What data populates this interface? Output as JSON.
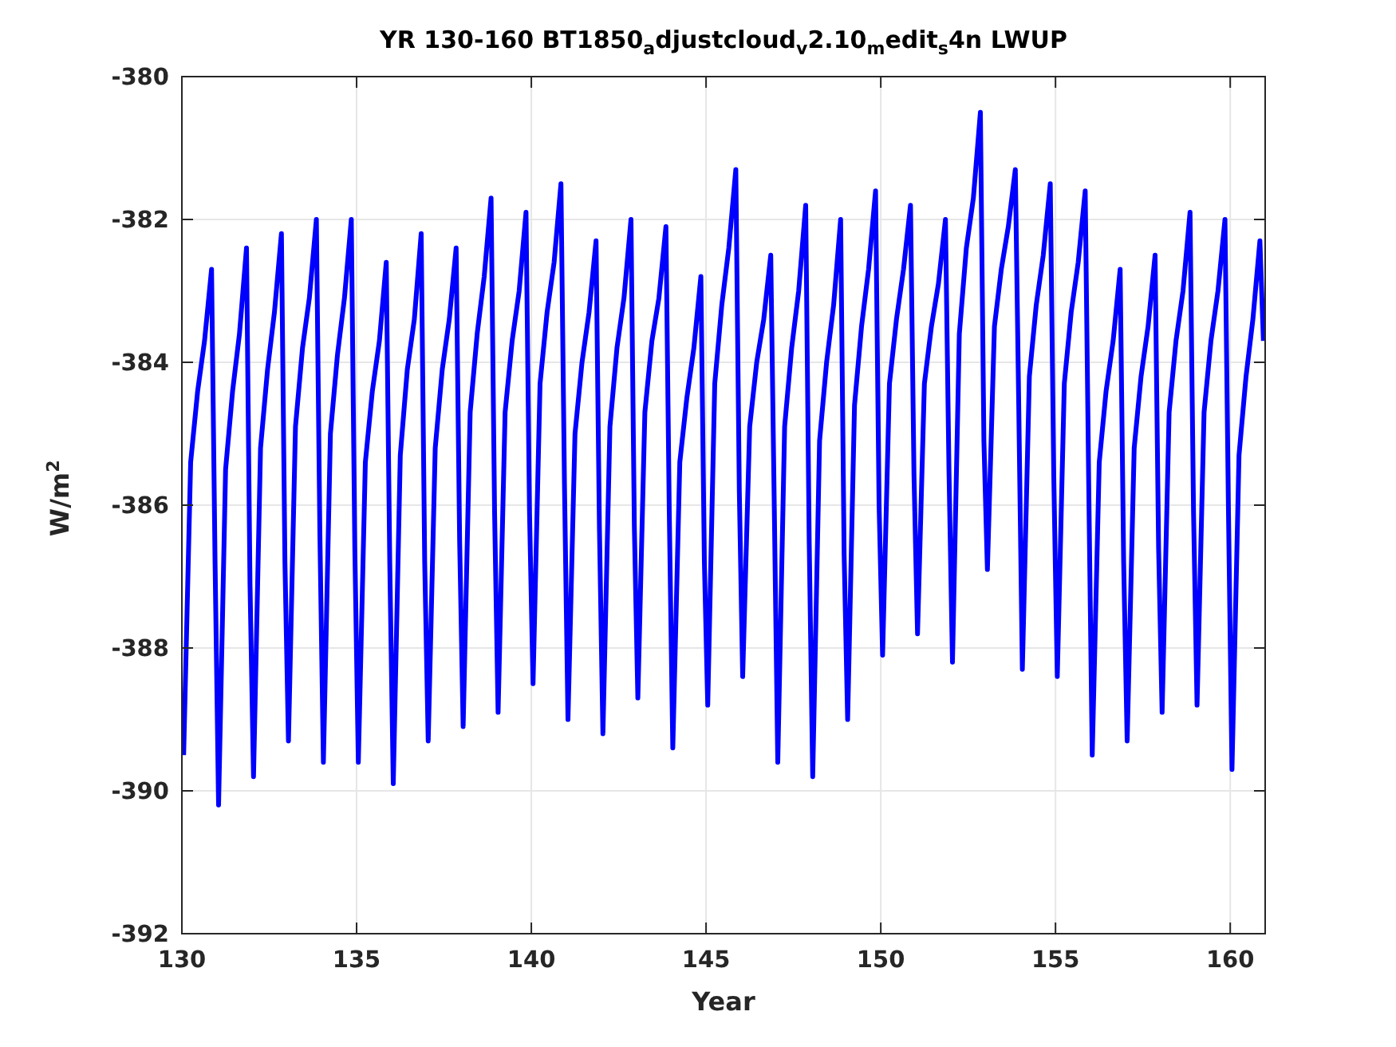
{
  "figure": {
    "chart_data": {
      "type": "line",
      "title": "YR 130-160 BT1850$_{a}$djustcloud$_{v}$2.10$_{m}$edit$_{s}$4n LWUP",
      "xlabel": "Year",
      "ylabel": "W/m$^{2}$",
      "xlim": [
        130,
        161
      ],
      "ylim": [
        -392,
        -380
      ],
      "grid": true,
      "xticks": [
        130,
        135,
        140,
        145,
        150,
        155,
        160
      ],
      "yticks": [
        -392,
        -390,
        -388,
        -386,
        -384,
        -382,
        -380
      ],
      "x": [
        130.05,
        130.25,
        130.45,
        130.65,
        130.85,
        130.95,
        131.05,
        131.25,
        131.45,
        131.65,
        131.85,
        131.95,
        132.05,
        132.25,
        132.45,
        132.65,
        132.85,
        132.95,
        133.05,
        133.25,
        133.45,
        133.65,
        133.85,
        133.95,
        134.05,
        134.25,
        134.45,
        134.65,
        134.85,
        134.95,
        135.05,
        135.25,
        135.45,
        135.65,
        135.85,
        135.95,
        136.05,
        136.25,
        136.45,
        136.65,
        136.85,
        136.95,
        137.05,
        137.25,
        137.45,
        137.65,
        137.85,
        137.95,
        138.05,
        138.25,
        138.45,
        138.65,
        138.85,
        138.95,
        139.05,
        139.25,
        139.45,
        139.65,
        139.85,
        139.95,
        140.05,
        140.25,
        140.45,
        140.65,
        140.85,
        140.95,
        141.05,
        141.25,
        141.45,
        141.65,
        141.85,
        141.95,
        142.05,
        142.25,
        142.45,
        142.65,
        142.85,
        142.95,
        143.05,
        143.25,
        143.45,
        143.65,
        143.85,
        143.95,
        144.05,
        144.25,
        144.45,
        144.65,
        144.85,
        144.95,
        145.05,
        145.25,
        145.45,
        145.65,
        145.85,
        145.95,
        146.05,
        146.25,
        146.45,
        146.65,
        146.85,
        146.95,
        147.05,
        147.25,
        147.45,
        147.65,
        147.85,
        147.95,
        148.05,
        148.25,
        148.45,
        148.65,
        148.85,
        148.95,
        149.05,
        149.25,
        149.45,
        149.65,
        149.85,
        149.95,
        150.05,
        150.25,
        150.45,
        150.65,
        150.85,
        150.95,
        151.05,
        151.25,
        151.45,
        151.65,
        151.85,
        151.95,
        152.05,
        152.25,
        152.45,
        152.65,
        152.85,
        152.95,
        153.05,
        153.25,
        153.45,
        153.65,
        153.85,
        153.95,
        154.05,
        154.25,
        154.45,
        154.65,
        154.85,
        154.95,
        155.05,
        155.25,
        155.45,
        155.65,
        155.85,
        155.95,
        156.05,
        156.25,
        156.45,
        156.65,
        156.85,
        156.95,
        157.05,
        157.25,
        157.45,
        157.65,
        157.85,
        157.95,
        158.05,
        158.25,
        158.45,
        158.65,
        158.85,
        158.95,
        159.05,
        159.25,
        159.45,
        159.65,
        159.85,
        159.95,
        160.05,
        160.25,
        160.45,
        160.65,
        160.85,
        160.95
      ],
      "series": [
        {
          "color": "#0000ff",
          "values": [
            -389.5,
            -385.4,
            -384.4,
            -383.7,
            -382.7,
            -386.8,
            -390.2,
            -385.5,
            -384.4,
            -383.6,
            -382.4,
            -387.1,
            -389.8,
            -385.2,
            -384.1,
            -383.3,
            -382.2,
            -386.8,
            -389.3,
            -384.9,
            -383.8,
            -383.1,
            -382.0,
            -386.4,
            -389.6,
            -385.0,
            -383.9,
            -383.1,
            -382.0,
            -386.6,
            -389.6,
            -385.4,
            -384.4,
            -383.7,
            -382.6,
            -386.8,
            -389.9,
            -385.3,
            -384.1,
            -383.4,
            -382.2,
            -386.8,
            -389.3,
            -385.2,
            -384.1,
            -383.4,
            -382.4,
            -386.5,
            -389.1,
            -384.7,
            -383.6,
            -382.8,
            -381.7,
            -386.1,
            -388.9,
            -384.7,
            -383.7,
            -383.0,
            -381.9,
            -386.1,
            -388.5,
            -384.3,
            -383.3,
            -382.6,
            -381.5,
            -385.7,
            -389.0,
            -385.0,
            -384.0,
            -383.3,
            -382.3,
            -386.3,
            -389.2,
            -384.9,
            -383.8,
            -383.1,
            -382.0,
            -386.3,
            -388.7,
            -384.7,
            -383.7,
            -383.1,
            -382.1,
            -386.1,
            -389.4,
            -385.4,
            -384.5,
            -383.8,
            -382.8,
            -386.8,
            -388.8,
            -384.3,
            -383.2,
            -382.4,
            -381.3,
            -385.8,
            -388.4,
            -384.9,
            -384.0,
            -383.4,
            -382.5,
            -386.0,
            -389.6,
            -384.9,
            -383.8,
            -383.0,
            -381.8,
            -386.5,
            -389.8,
            -385.1,
            -384.0,
            -383.2,
            -382.0,
            -386.7,
            -389.0,
            -384.6,
            -383.5,
            -382.7,
            -381.6,
            -386.0,
            -388.1,
            -384.3,
            -383.4,
            -382.7,
            -381.8,
            -385.6,
            -387.8,
            -384.3,
            -383.5,
            -382.9,
            -382.0,
            -385.5,
            -388.2,
            -383.6,
            -382.4,
            -381.7,
            -380.5,
            -385.1,
            -386.9,
            -383.5,
            -382.7,
            -382.1,
            -381.3,
            -384.7,
            -388.3,
            -384.2,
            -383.2,
            -382.5,
            -381.5,
            -385.6,
            -388.4,
            -384.3,
            -383.3,
            -382.6,
            -381.6,
            -385.7,
            -389.5,
            -385.4,
            -384.4,
            -383.7,
            -382.7,
            -386.8,
            -389.3,
            -385.2,
            -384.2,
            -383.5,
            -382.5,
            -386.6,
            -388.9,
            -384.7,
            -383.7,
            -383.0,
            -381.9,
            -386.1,
            -388.8,
            -384.7,
            -383.7,
            -383.0,
            -382.0,
            -386.1,
            -389.7,
            -385.3,
            -384.2,
            -383.4,
            -382.3,
            -383.7
          ]
        }
      ]
    }
  }
}
